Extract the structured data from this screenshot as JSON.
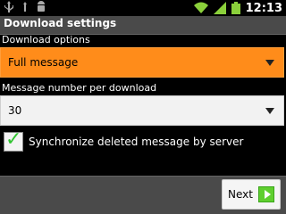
{
  "status_bar": {
    "time": "12:13",
    "icons": [
      "usb-icon",
      "usb-debug-icon",
      "android-icon",
      "wifi-icon",
      "signal-icon",
      "battery-icon"
    ],
    "colors": {
      "wifi": "#8bd03b",
      "battery": "#8bd03b"
    }
  },
  "title_bar": {
    "title": "Download settings"
  },
  "download_options": {
    "label": "Download options",
    "selected_value": "Full message",
    "accent_color": "#ff8c1a"
  },
  "message_number": {
    "label": "Message number per download",
    "selected_value": "30"
  },
  "sync_checkbox": {
    "label": "Synchronize deleted message by server",
    "checked": true
  },
  "bottom_bar": {
    "next_label": "Next",
    "next_icon": "arrow-right-icon",
    "next_icon_color": "#5fcf2f"
  }
}
